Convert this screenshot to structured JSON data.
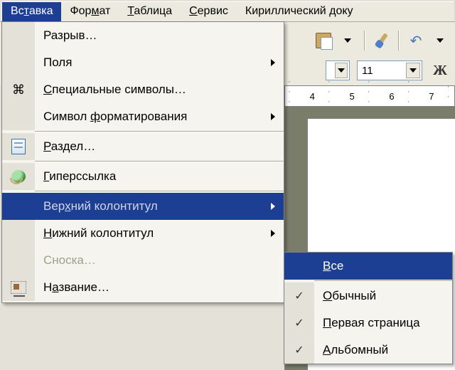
{
  "menubar": {
    "items": [
      {
        "label": "Вставка",
        "mnemonic_index": 2,
        "active": true
      },
      {
        "label": "Формат",
        "mnemonic_index": 3,
        "active": false
      },
      {
        "label": "Таблица",
        "mnemonic_index": 0,
        "active": false
      },
      {
        "label": "Сервис",
        "mnemonic_index": 0,
        "active": false
      },
      {
        "label": "Кириллический доку",
        "mnemonic_index": -1,
        "active": false
      }
    ]
  },
  "toolbar": {
    "font_size_value": "11",
    "bold_glyph": "Ж"
  },
  "ruler_numbers": [
    "4",
    "5",
    "6",
    "7"
  ],
  "insert_menu": {
    "items": [
      {
        "label": "Разрыв…",
        "mnemonic_index": -1,
        "icon": null,
        "submenu": false,
        "disabled": false,
        "highlighted": false
      },
      {
        "label": "Поля",
        "mnemonic_index": -1,
        "icon": null,
        "submenu": true,
        "disabled": false,
        "highlighted": false
      },
      {
        "label": "Специальные символы…",
        "mnemonic_index": 0,
        "icon": "special-chars-icon",
        "submenu": false,
        "disabled": false,
        "highlighted": false
      },
      {
        "label": "Символ форматирования",
        "mnemonic_index": 7,
        "icon": null,
        "submenu": true,
        "disabled": false,
        "highlighted": false
      },
      {
        "sep": true
      },
      {
        "label": "Раздел…",
        "mnemonic_index": 0,
        "icon": "section-icon",
        "submenu": false,
        "disabled": false,
        "highlighted": false
      },
      {
        "sep": true
      },
      {
        "label": "Гиперссылка",
        "mnemonic_index": 0,
        "icon": "globe-icon",
        "submenu": false,
        "disabled": false,
        "highlighted": false
      },
      {
        "sep": true
      },
      {
        "label": "Верхний колонтитул",
        "mnemonic_index": 3,
        "icon": null,
        "submenu": true,
        "disabled": false,
        "highlighted": true
      },
      {
        "label": "Нижний колонтитул",
        "mnemonic_index": 0,
        "icon": null,
        "submenu": true,
        "disabled": false,
        "highlighted": false
      },
      {
        "label": "Сноска…",
        "mnemonic_index": -1,
        "icon": null,
        "submenu": false,
        "disabled": true,
        "highlighted": false
      },
      {
        "label": "Название…",
        "mnemonic_index": 1,
        "icon": "caption-icon",
        "submenu": false,
        "disabled": false,
        "highlighted": false
      }
    ]
  },
  "header_submenu": {
    "items": [
      {
        "label": "Все",
        "mnemonic_index": 0,
        "checked": false,
        "highlighted": true
      },
      {
        "sep": true
      },
      {
        "label": "Обычный",
        "mnemonic_index": 0,
        "checked": true,
        "highlighted": false
      },
      {
        "label": "Первая страница",
        "mnemonic_index": 0,
        "checked": true,
        "highlighted": false
      },
      {
        "label": "Альбомный",
        "mnemonic_index": 0,
        "checked": true,
        "highlighted": false
      }
    ]
  }
}
